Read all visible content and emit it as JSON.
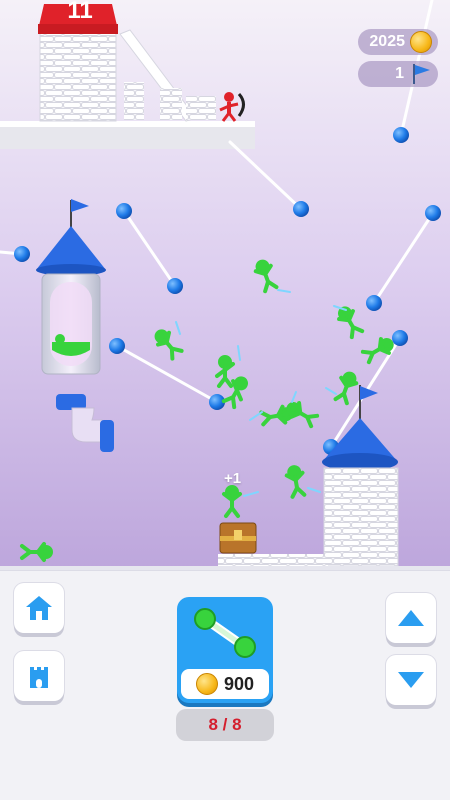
{
  "hud": {
    "coins": "2025",
    "levels": "1",
    "coin_icon": "coin-icon",
    "flag_icon": "flag-icon"
  },
  "scene": {
    "top_tower_number": "11",
    "spawn_popup": "+1",
    "colors": {
      "sky_top": "#f3eef7",
      "sky_bottom": "#bfa8dc",
      "stickman": "#38d33d",
      "enemy": "#e0222a",
      "tower_roof": "#2b6be3",
      "node": "#1f7be8"
    }
  },
  "bottom": {
    "upgrade_price": "900",
    "upgrade_count": "8 / 8",
    "upgrade_icon": "link-icon",
    "home_icon": "home-icon",
    "castle_icon": "castle-icon",
    "up_icon": "arrow-up-icon",
    "down_icon": "arrow-down-icon"
  }
}
